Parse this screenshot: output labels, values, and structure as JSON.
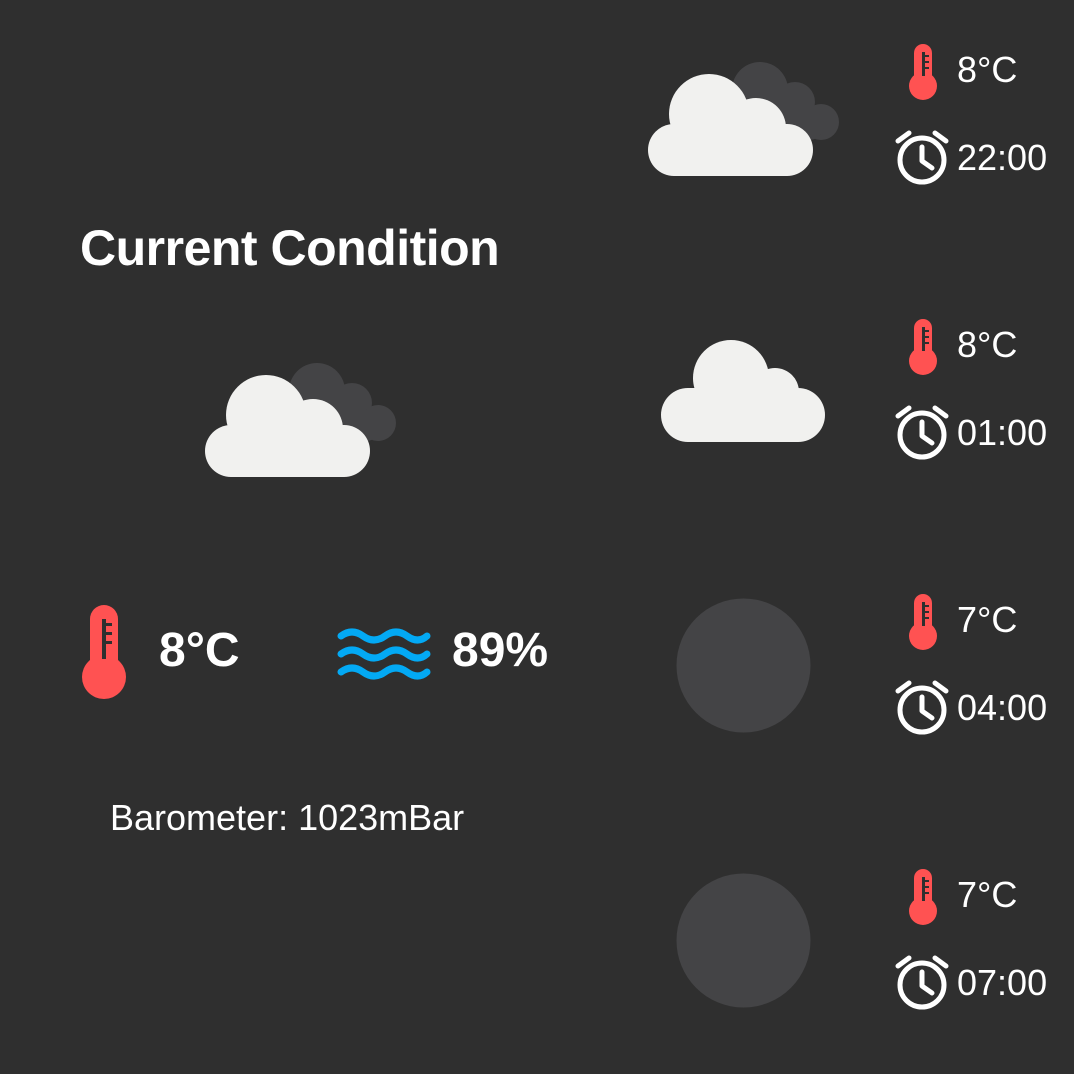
{
  "current": {
    "title": "Current Condition",
    "condition_icon": "partly-cloudy-icon",
    "temperature": "8°C",
    "humidity": "89%",
    "barometer_label": "Barometer:",
    "barometer_value": "1023mBar"
  },
  "forecast": [
    {
      "temperature": "8°C",
      "time": "22:00",
      "condition_icon": "partly-cloudy-icon"
    },
    {
      "temperature": "8°C",
      "time": "01:00",
      "condition_icon": "cloud-icon"
    },
    {
      "temperature": "7°C",
      "time": "04:00",
      "condition_icon": "clear-night-icon"
    },
    {
      "temperature": "7°C",
      "time": "07:00",
      "condition_icon": "clear-night-icon"
    }
  ],
  "colors": {
    "background": "#2f2f2f",
    "thermometer": "#ff5252",
    "humidity_waves": "#03a9f4",
    "cloud": "#f1f1ef",
    "cloud_shadow": "#444446",
    "moon": "#444446"
  }
}
